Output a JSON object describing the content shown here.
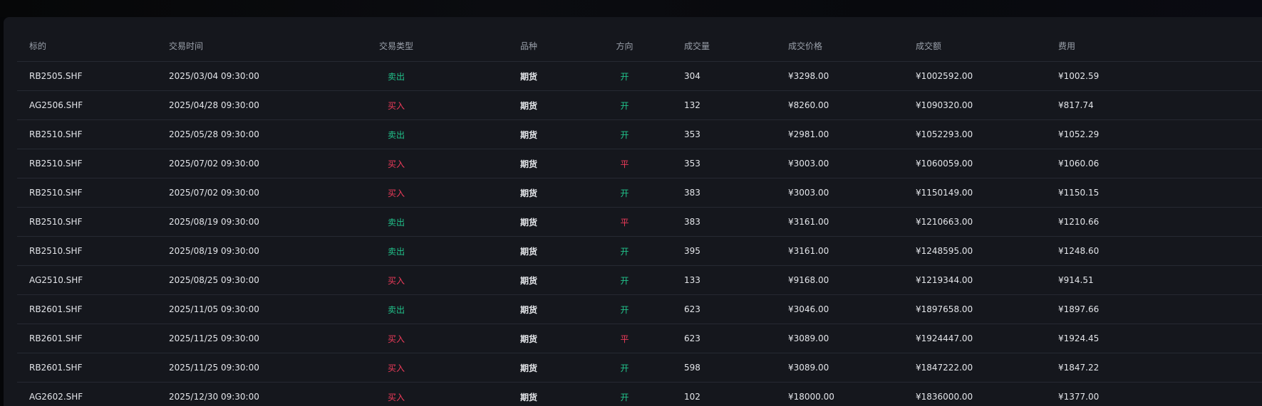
{
  "table": {
    "headers": [
      "标的",
      "交易时间",
      "交易类型",
      "品种",
      "方向",
      "成交量",
      "成交价格",
      "成交额",
      "费用"
    ],
    "rows": [
      {
        "symbol": "RB2505.SHF",
        "time": "2025/03/04 09:30:00",
        "type": "卖出",
        "variety": "期货",
        "direction": "开",
        "volume": "304",
        "price": "¥3298.00",
        "amount": "¥1002592.00",
        "fee": "¥1002.59"
      },
      {
        "symbol": "AG2506.SHF",
        "time": "2025/04/28 09:30:00",
        "type": "买入",
        "variety": "期货",
        "direction": "开",
        "volume": "132",
        "price": "¥8260.00",
        "amount": "¥1090320.00",
        "fee": "¥817.74"
      },
      {
        "symbol": "RB2510.SHF",
        "time": "2025/05/28 09:30:00",
        "type": "卖出",
        "variety": "期货",
        "direction": "开",
        "volume": "353",
        "price": "¥2981.00",
        "amount": "¥1052293.00",
        "fee": "¥1052.29"
      },
      {
        "symbol": "RB2510.SHF",
        "time": "2025/07/02 09:30:00",
        "type": "买入",
        "variety": "期货",
        "direction": "平",
        "volume": "353",
        "price": "¥3003.00",
        "amount": "¥1060059.00",
        "fee": "¥1060.06"
      },
      {
        "symbol": "RB2510.SHF",
        "time": "2025/07/02 09:30:00",
        "type": "买入",
        "variety": "期货",
        "direction": "开",
        "volume": "383",
        "price": "¥3003.00",
        "amount": "¥1150149.00",
        "fee": "¥1150.15"
      },
      {
        "symbol": "RB2510.SHF",
        "time": "2025/08/19 09:30:00",
        "type": "卖出",
        "variety": "期货",
        "direction": "平",
        "volume": "383",
        "price": "¥3161.00",
        "amount": "¥1210663.00",
        "fee": "¥1210.66"
      },
      {
        "symbol": "RB2510.SHF",
        "time": "2025/08/19 09:30:00",
        "type": "卖出",
        "variety": "期货",
        "direction": "开",
        "volume": "395",
        "price": "¥3161.00",
        "amount": "¥1248595.00",
        "fee": "¥1248.60"
      },
      {
        "symbol": "AG2510.SHF",
        "time": "2025/08/25 09:30:00",
        "type": "买入",
        "variety": "期货",
        "direction": "开",
        "volume": "133",
        "price": "¥9168.00",
        "amount": "¥1219344.00",
        "fee": "¥914.51"
      },
      {
        "symbol": "RB2601.SHF",
        "time": "2025/11/05 09:30:00",
        "type": "卖出",
        "variety": "期货",
        "direction": "开",
        "volume": "623",
        "price": "¥3046.00",
        "amount": "¥1897658.00",
        "fee": "¥1897.66"
      },
      {
        "symbol": "RB2601.SHF",
        "time": "2025/11/25 09:30:00",
        "type": "买入",
        "variety": "期货",
        "direction": "平",
        "volume": "623",
        "price": "¥3089.00",
        "amount": "¥1924447.00",
        "fee": "¥1924.45"
      },
      {
        "symbol": "RB2601.SHF",
        "time": "2025/11/25 09:30:00",
        "type": "买入",
        "variety": "期货",
        "direction": "开",
        "volume": "598",
        "price": "¥3089.00",
        "amount": "¥1847222.00",
        "fee": "¥1847.22"
      },
      {
        "symbol": "AG2602.SHF",
        "time": "2025/12/30 09:30:00",
        "type": "买入",
        "variety": "期货",
        "direction": "开",
        "volume": "102",
        "price": "¥18000.00",
        "amount": "¥1836000.00",
        "fee": "¥1377.00"
      }
    ]
  },
  "colors": {
    "sell": "#21c38b",
    "buy": "#ef3b5a",
    "open": "#21c38b",
    "close": "#ef3b5a"
  }
}
